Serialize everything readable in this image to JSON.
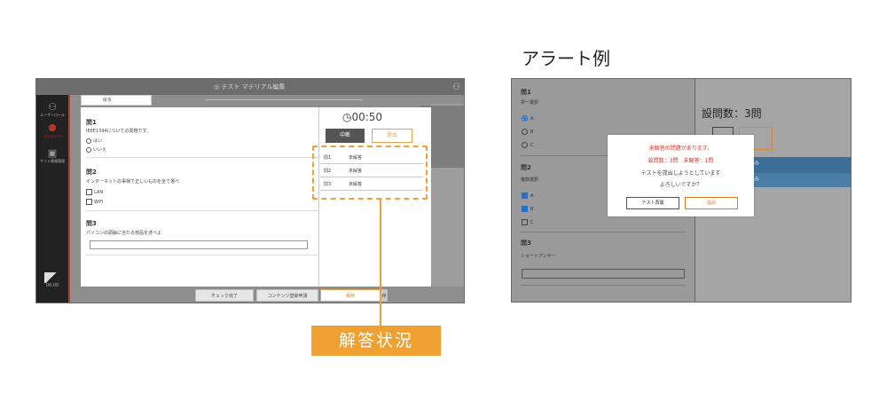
{
  "left_screen": {
    "title": "テスト マテリアル編集",
    "sidebar": [
      {
        "label": "ユーザーロール"
      },
      {
        "label": "コンテンツ"
      },
      {
        "label": "サイト情報管理"
      }
    ],
    "clock": "00:00",
    "back_label": "戻る",
    "questions": [
      {
        "title": "問1",
        "text": "IEEE1394についての問題です。",
        "options": [
          "はい",
          "いいえ"
        ]
      },
      {
        "title": "問2",
        "text": "インターネットの事柄で正しいものを全て選べ",
        "options": [
          "LAN",
          "WiFi"
        ]
      },
      {
        "title": "問3",
        "text": "パソコンの頭脳に当たる部品を述べよ"
      }
    ],
    "timer": "00:50",
    "pause_label": "中断",
    "submit_label": "提出",
    "answer_status": [
      {
        "q": "問1",
        "status": "未解答"
      },
      {
        "q": "問2",
        "status": "未解答"
      },
      {
        "q": "問3",
        "status": "未解答"
      }
    ],
    "bottom_buttons": {
      "check_done": "チェック完了",
      "request": "コンテンツ登録申請",
      "save": "保存",
      "last": "存"
    }
  },
  "highlight_label": "解答状況",
  "alert_heading": "アラート例",
  "right_screen": {
    "questions": [
      {
        "title": "問1",
        "subtitle": "択一選択",
        "options": [
          "A",
          "B",
          "C"
        ]
      },
      {
        "title": "問2",
        "subtitle": "複数選択",
        "options": [
          "A",
          "B",
          "C"
        ]
      },
      {
        "title": "問3",
        "subtitle": "ショートアンサー"
      }
    ],
    "question_count": "設問数：3問",
    "box_text": "み",
    "alert": {
      "line1": "未解答の問題があります。",
      "line2": "設問数：3問　未解答：1問",
      "line3": "テストを提出しようとしています",
      "line4": "よろしいですか？",
      "retry_label": "テスト再開",
      "submit_label": "提出"
    }
  },
  "colors": {
    "accent": "#f0a030",
    "alert_red": "#d9342b",
    "selected_blue": "#2c6fc0"
  }
}
